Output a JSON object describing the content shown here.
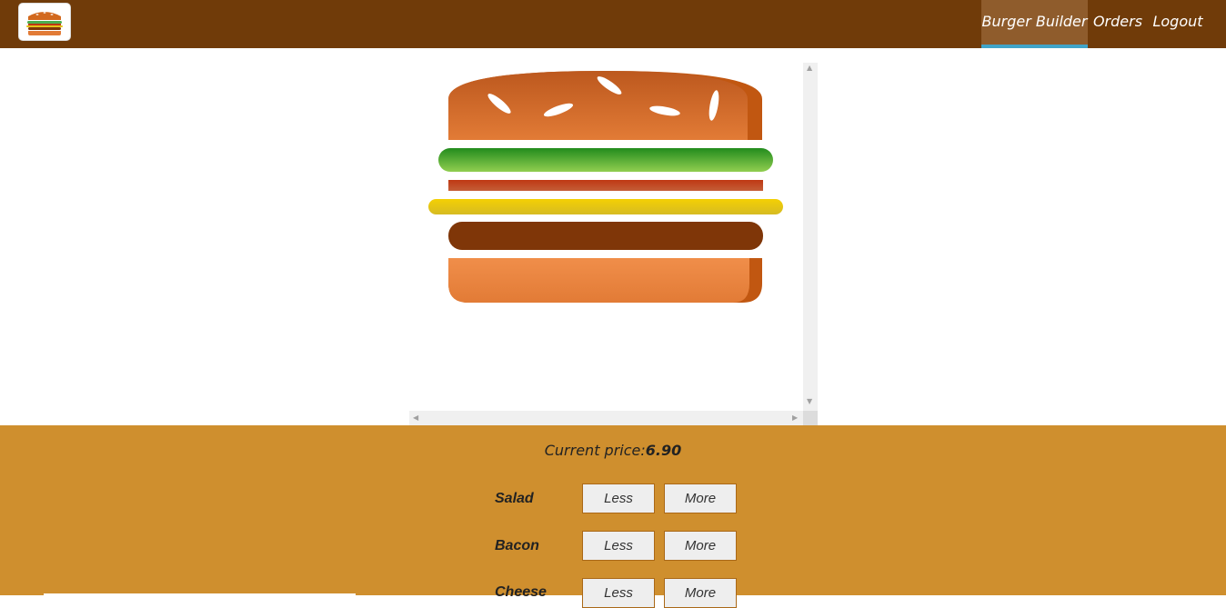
{
  "nav": {
    "items": [
      {
        "label": "Burger Builder",
        "active": true
      },
      {
        "label": "Orders",
        "active": false
      },
      {
        "label": "Logout",
        "active": false
      }
    ]
  },
  "logo": {
    "icon": "burger-logo-icon"
  },
  "price": {
    "label": "Current price:",
    "value": "6.90"
  },
  "controls": [
    {
      "label": "Salad",
      "less": "Less",
      "more": "More"
    },
    {
      "label": "Bacon",
      "less": "Less",
      "more": "More"
    },
    {
      "label": "Cheese",
      "less": "Less",
      "more": "More"
    }
  ],
  "colors": {
    "toolbar": "#703B09",
    "active_nav": "#8F5C2C",
    "active_border": "#40A4C8",
    "controls_bg": "#CF8F2E",
    "salad": "#4CAF50",
    "bacon": "#BF3813",
    "cheese": "#E6C21A",
    "meat": "#7F3608",
    "bread": "#E27B36"
  }
}
